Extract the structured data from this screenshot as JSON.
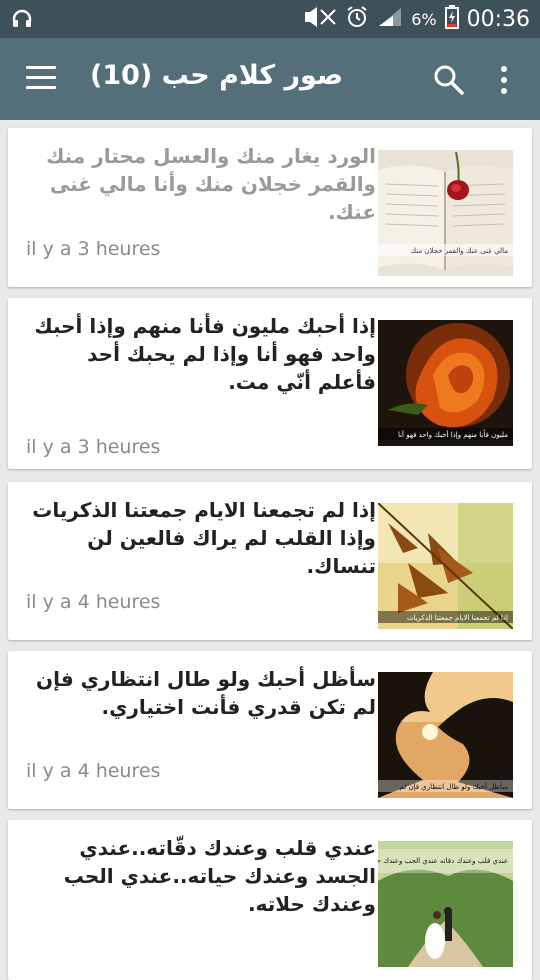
{
  "status_bar": {
    "battery": "6%",
    "time": "00:36",
    "icons": [
      "headset-icon",
      "mute-icon",
      "alarm-icon",
      "signal-icon",
      "battery-icon"
    ]
  },
  "app_bar": {
    "title": "صور كلام حب (10)",
    "icons": [
      "menu-icon",
      "search-icon",
      "overflow-icon"
    ],
    "color": "#546e7a"
  },
  "posts": [
    {
      "text": "الورد يغار منك والعسل محتار منك والقمر خجلان منك وأنا مالي غنى عنك.",
      "time": "il y a 3 heures",
      "image_caption": "مالي غنى عنك والقمر خجلان منك"
    },
    {
      "text": "إذا أحبك مليون فأنا منهم وإذا أحبك واحد فهو أنا وإذا لم يحبك أحد فأعلم أنّي مت.",
      "time": "il y a 3 heures",
      "image_caption": "مليون فأنا منهم وإذا أحبك واحد فهو أنا"
    },
    {
      "text": "إذا لم تجمعنا الايام جمعتنا الذكريات وإذا القلب لم يراك فالعين لن تنساك.",
      "time": "il y a 4 heures",
      "image_caption": "إذا لم تجمعنا الايام جمعتنا الذكريات"
    },
    {
      "text": "سأظل أحبك ولو طال انتظاري فإن لم تكن قدري فأنت اختياري.",
      "time": "il y a 4 heures",
      "image_caption": "سأظل أحبك ولو طال انتظاري فإن لم"
    },
    {
      "text": "عندي قلب وعندك دقّاته..عندي الجسد وعندك حياته..عندي الحب وعندك حلاته.",
      "time": "",
      "image_caption": "عندي قلب وعندك دقاته عندي الحب وعندك حلاته"
    }
  ]
}
